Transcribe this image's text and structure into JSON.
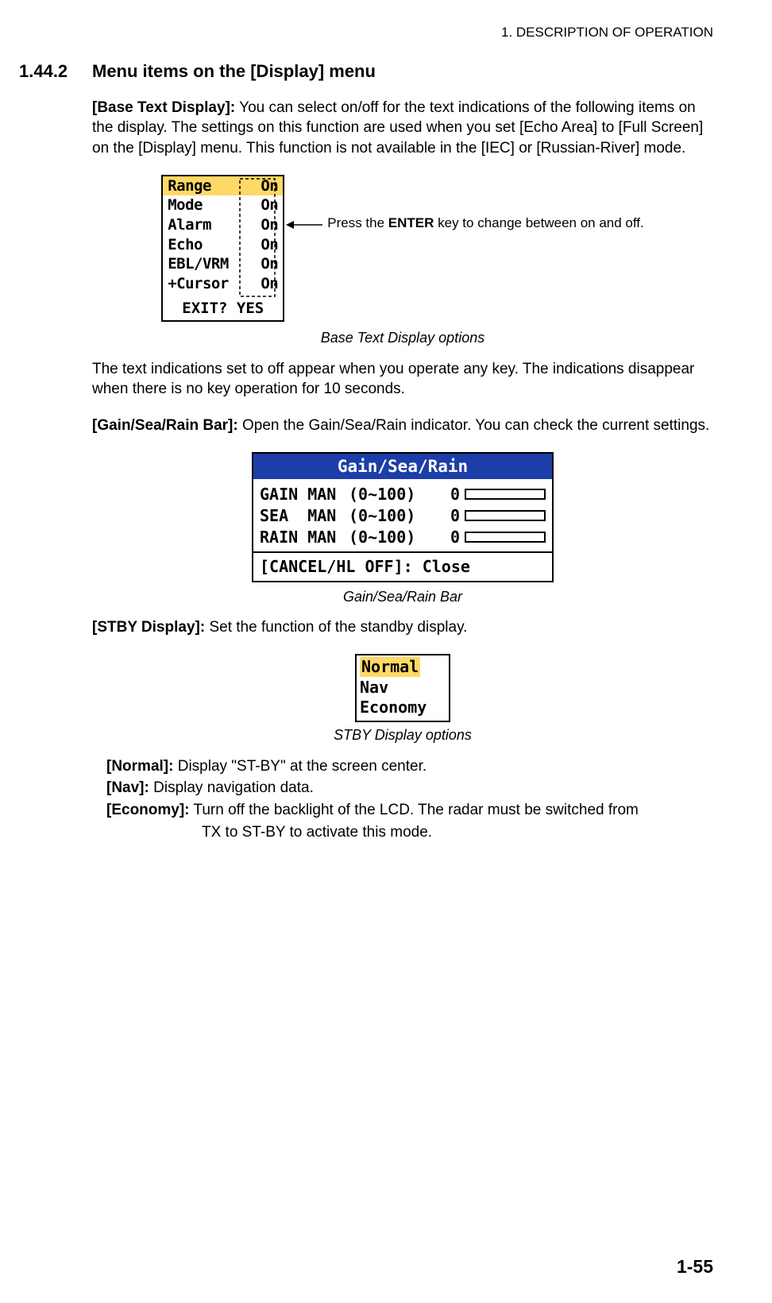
{
  "header": {
    "chapter": "1.  DESCRIPTION OF OPERATION"
  },
  "section": {
    "number": "1.44.2",
    "title": "Menu items on the [Display] menu"
  },
  "p1": {
    "lead": "[Base Text Display]:",
    "rest": " You can select on/off for the text indications of the following items on the display. The settings on this function are used when you set [Echo Area] to [Full Screen] on the [Display] menu. This function is not available in the [IEC] or [Russian-River] mode."
  },
  "fig1": {
    "rows": [
      {
        "label": "Range",
        "val": "On"
      },
      {
        "label": "Mode",
        "val": "On"
      },
      {
        "label": "Alarm",
        "val": "On"
      },
      {
        "label": "Echo",
        "val": "On"
      },
      {
        "label": "EBL/VRM",
        "val": "On"
      },
      {
        "label": "+Cursor",
        "val": "On"
      }
    ],
    "exit": "EXIT? YES",
    "annot1": "Press the ",
    "annot_key": "ENTER",
    "annot2": " key to change between on and off.",
    "caption": "Base Text Display options"
  },
  "p2": "The text indications set to off appear when you operate any key. The indications disappear when there is no key operation for 10 seconds.",
  "p3": {
    "lead": "[Gain/Sea/Rain Bar]:",
    "rest": " Open the Gain/Sea/Rain indicator. You can check the current settings."
  },
  "fig2": {
    "title": "Gain/Sea/Rain",
    "rows": [
      {
        "label": "GAIN MAN",
        "range": "(0~100)",
        "val": "0"
      },
      {
        "label": "SEA  MAN",
        "range": "(0~100)",
        "val": "0"
      },
      {
        "label": "RAIN MAN",
        "range": "(0~100)",
        "val": "0"
      }
    ],
    "footer": "[CANCEL/HL OFF]: Close",
    "caption": "Gain/Sea/Rain Bar"
  },
  "p4": {
    "lead": "[STBY Display]:",
    "rest": " Set the function of the standby display."
  },
  "fig3": {
    "items": [
      "Normal",
      "Nav",
      "Economy"
    ],
    "caption": "STBY Display options"
  },
  "defs": {
    "normal_lead": "[Normal]:",
    "normal_rest": " Display \"ST-BY\" at the screen center.",
    "nav_lead": "[Nav]:",
    "nav_rest": " Display navigation data.",
    "econ_lead": "[Economy]:",
    "econ_rest": " Turn off the backlight of the LCD. The radar must be switched from",
    "econ_cont": "TX to ST-BY to activate this mode."
  },
  "page": "1-55"
}
